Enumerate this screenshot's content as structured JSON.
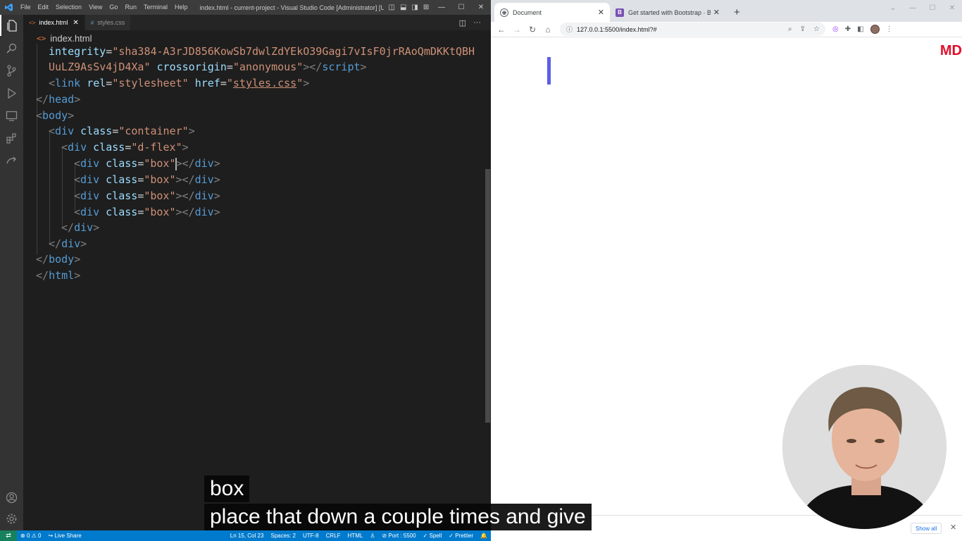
{
  "vscode": {
    "menu": [
      "File",
      "Edit",
      "Selection",
      "View",
      "Go",
      "Run",
      "Terminal",
      "Help"
    ],
    "window_title": "index.html - current-project - Visual Studio Code [Administrator] [Unsup...",
    "tabs": [
      {
        "label": "index.html",
        "icon": "html-icon",
        "active": true
      },
      {
        "label": "styles.css",
        "icon": "css-icon",
        "active": false
      }
    ],
    "breadcrumb": "index.html",
    "code": {
      "integrity_attr": "integrity",
      "integrity_value_1": "\"sha384-A3rJD856KowSb7dwlZdYEkO39Gagi7vIsF0jrRAoQmDKKtQBH",
      "integrity_value_2": "UuLZ9AsSv4jD4Xa\"",
      "crossorigin_attr": "crossorigin",
      "crossorigin_value": "\"anonymous\"",
      "script_tag": "script",
      "link_tag": "link",
      "rel_attr": "rel",
      "rel_value": "\"stylesheet\"",
      "href_attr": "href",
      "href_value": "styles.css",
      "head_tag": "head",
      "body_tag": "body",
      "div_tag": "div",
      "class_attr": "class",
      "container_value": "\"container\"",
      "dflex_value": "\"d-flex\"",
      "box_value": "\"box\"",
      "html_tag": "html"
    },
    "status": {
      "errors": "0",
      "warnings": "0",
      "live_share": "Live Share",
      "position": "Ln 15, Col 23",
      "spaces": "Spaces: 2",
      "encoding": "UTF-8",
      "eol": "CRLF",
      "language": "HTML",
      "port": "Port : 5500",
      "spell": "Spell",
      "prettier": "Prettier"
    }
  },
  "browser": {
    "tabs": [
      {
        "label": "Document",
        "active": true
      },
      {
        "label": "Get started with Bootstrap · Boot",
        "active": false
      }
    ],
    "url": "127.0.0.1:5500/index.html?#",
    "page": {
      "badge": "MD",
      "box_color": "#5a5fe6"
    },
    "download_bar": {
      "show_all": "Show all"
    }
  },
  "captions": {
    "line1": "box",
    "line2": "place that down a couple times and give"
  },
  "colors": {
    "editor_bg": "#1e1e1e",
    "statusbar": "#007acc",
    "remote_indicator": "#16825d",
    "tag": "#569cd6",
    "attribute": "#9cdcfe",
    "string": "#ce9178"
  }
}
